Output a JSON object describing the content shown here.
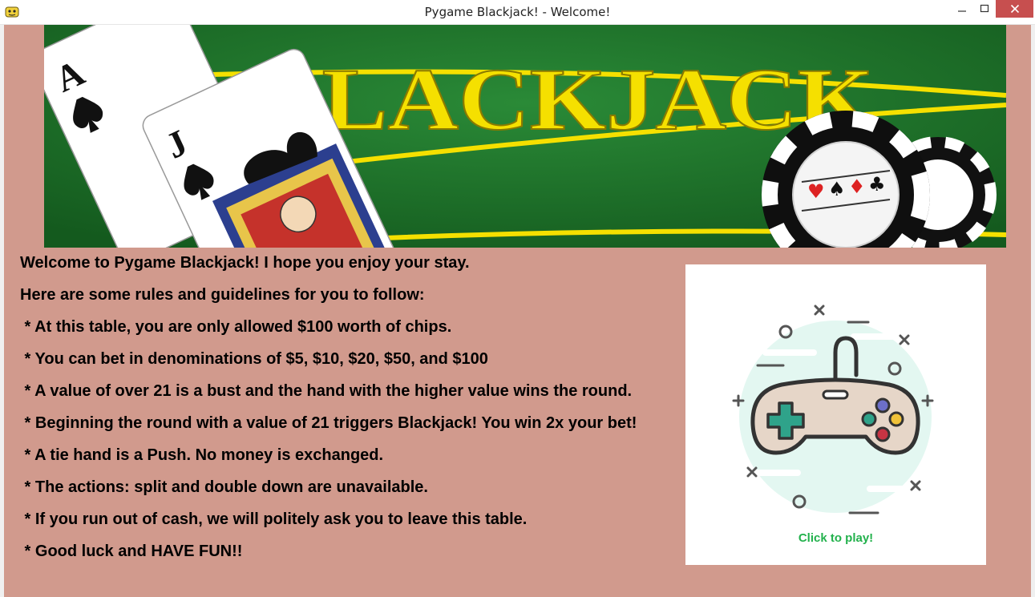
{
  "window": {
    "title": "Pygame Blackjack! - Welcome!"
  },
  "banner": {
    "logo_text": "BLACKJACK",
    "card_ace_rank": "A",
    "card_jack_rank": "J"
  },
  "content": {
    "lines": [
      "Welcome to Pygame Blackjack! I hope you enjoy your stay.",
      "Here are some rules and guidelines for you to follow:",
      " * At this table, you are only allowed $100 worth of chips.",
      " * You can bet in denominations of $5, $10, $20, $50, and $100",
      " * A value of over 21 is a bust and the hand with the higher value wins the round.",
      " * Beginning the round with a value of 21 triggers Blackjack! You win 2x your bet!",
      " * A tie hand is a Push. No money is exchanged.",
      " * The actions: split and double down are unavailable.",
      " * If you run out of cash, we will politely ask you to leave this table.",
      " * Good luck and HAVE FUN!!"
    ]
  },
  "play_button": {
    "label": "Click to play!",
    "icon": "gamepad-icon"
  },
  "colors": {
    "background": "#d19a8d",
    "felt": "#1f6b2a",
    "logo": "#f5e000",
    "play_label": "#22b14c"
  }
}
